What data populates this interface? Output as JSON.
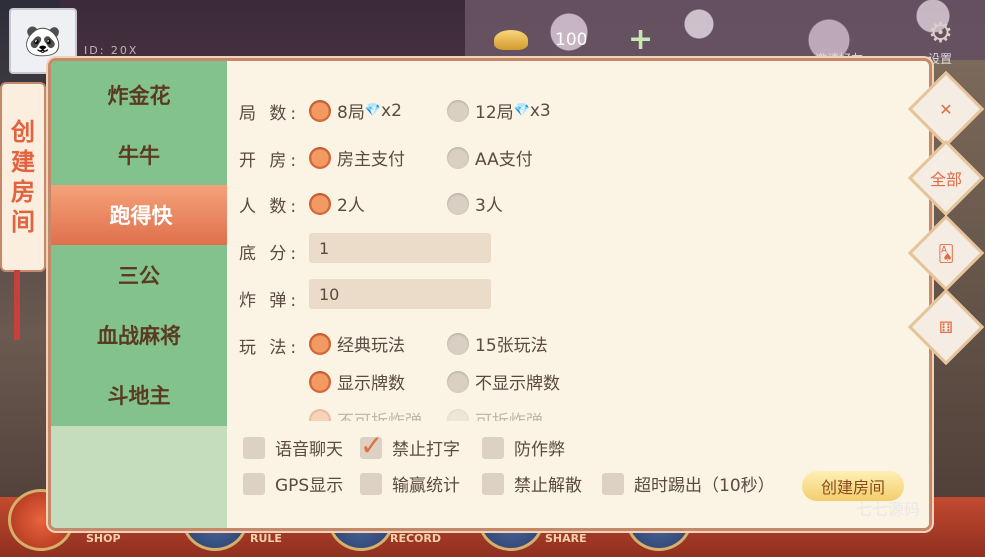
{
  "top": {
    "nickname": "ID: 20X",
    "gold": "100",
    "plus": "+",
    "labels": [
      "邀请好友",
      "设置"
    ]
  },
  "title_vertical": [
    "创",
    "建",
    "房",
    "间"
  ],
  "tabs": [
    "炸金花",
    "牛牛",
    "跑得快",
    "三公",
    "血战麻将",
    "斗地主"
  ],
  "active_tab": "跑得快",
  "form": {
    "rounds_label": "局 数:",
    "rounds_opt1": "8局",
    "rounds_opt1_mult": "x2",
    "rounds_opt2": "12局",
    "rounds_opt2_mult": "x3",
    "room_label": "开 房:",
    "room_opt1": "房主支付",
    "room_opt2": "AA支付",
    "people_label": "人 数:",
    "people_opt1": "2人",
    "people_opt2": "3人",
    "base_label": "底 分:",
    "base_value": "1",
    "bomb_label": "炸 弹:",
    "bomb_value": "10",
    "play_label": "玩 法:",
    "play_opt1": "经典玩法",
    "play_opt2": "15张玩法",
    "show_opt1": "显示牌数",
    "show_opt2": "不显示牌数",
    "split_opt1": "不可拆炸弹",
    "split_opt2": "可拆炸弹"
  },
  "checks": {
    "voice": "语音聊天",
    "no_type": "禁止打字",
    "anti_cheat": "防作弊",
    "gps": "GPS显示",
    "stats": "输赢统计",
    "no_dissolve": "禁止解散",
    "timeout": "超时踢出（10秒）"
  },
  "create_button": "创建房间",
  "side_buttons": [
    "全部"
  ],
  "bottom": [
    "SHOP",
    "RULE",
    "RECORD",
    "SHARE"
  ],
  "watermark": "七七源码",
  "colors": {
    "accent": "#e0704d",
    "tab_green": "#83c28c",
    "panel": "#fbf4e6"
  }
}
